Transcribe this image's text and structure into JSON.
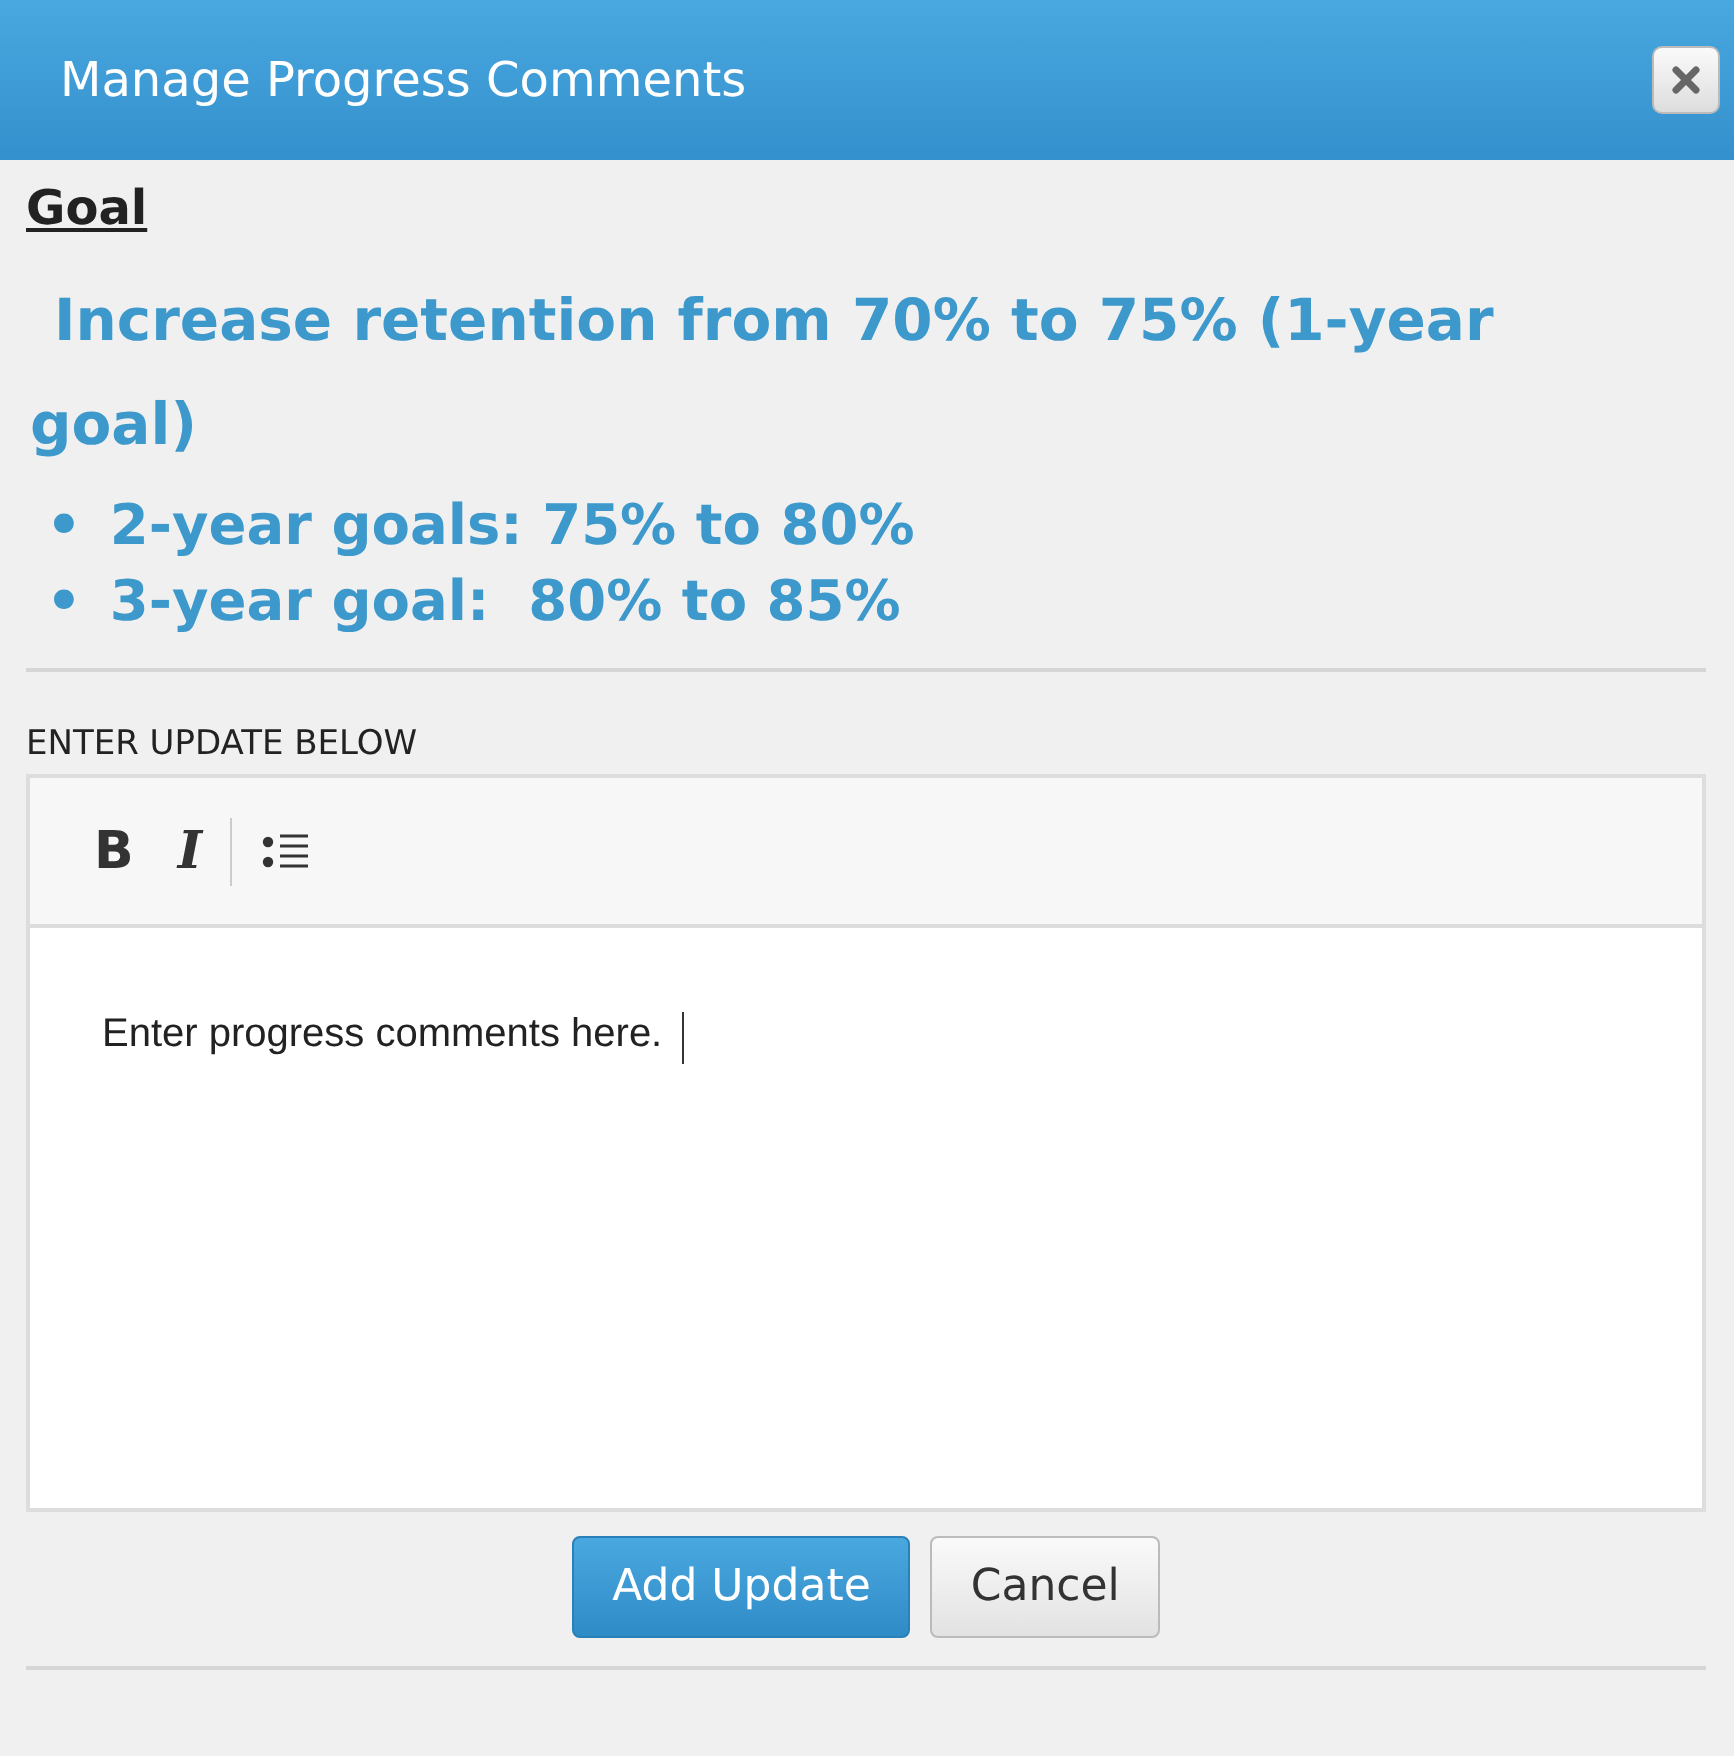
{
  "window": {
    "title": "Manage Progress Comments"
  },
  "goal": {
    "heading": "Goal",
    "text": "Increase retention from 70% to 75% (1-year goal)",
    "bullets": [
      {
        "marker": "•",
        "text": "2-year goals: 75% to 80%"
      },
      {
        "marker": "•",
        "text": "3-year goal:  80% to 85%"
      }
    ]
  },
  "editor": {
    "label": "ENTER UPDATE BELOW",
    "toolbar": [
      {
        "kind": "bold",
        "label": "B"
      },
      {
        "kind": "italic",
        "label": "I"
      },
      {
        "kind": "list"
      }
    ],
    "value": "Enter progress comments here."
  },
  "buttons": [
    {
      "label": "Add Update",
      "kind": "primary"
    },
    {
      "label": "Cancel",
      "kind": "secondary"
    }
  ]
}
